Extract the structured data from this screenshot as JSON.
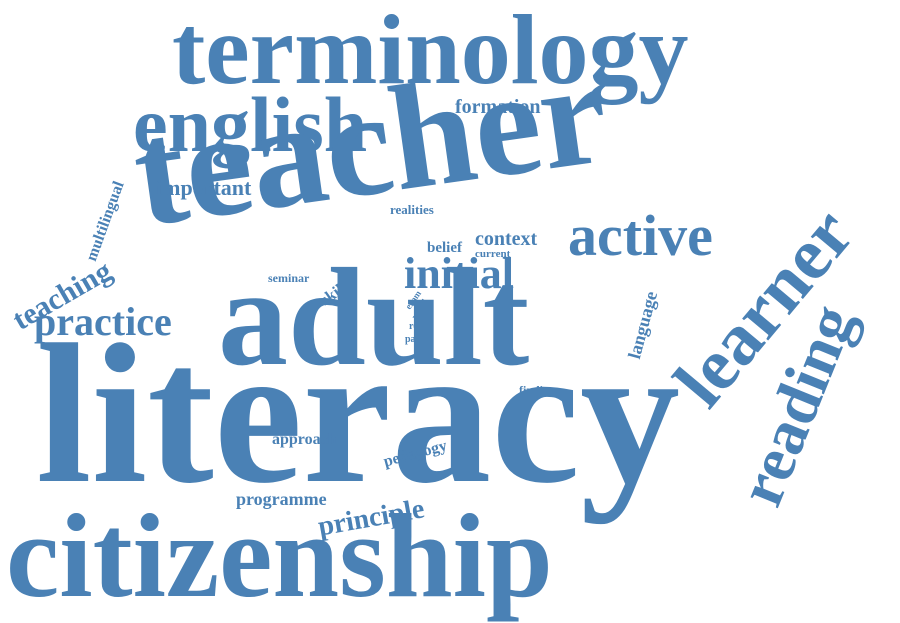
{
  "cloud": {
    "color": "#4a81b5",
    "words": [
      "terminology",
      "english",
      "formation",
      "teacher",
      "important",
      "multilingual",
      "learner",
      "active",
      "realities",
      "context",
      "belief",
      "current",
      "initial",
      "teaching",
      "seminar",
      "skill",
      "practice",
      "exam",
      "need",
      "role",
      "paper",
      "cohort",
      "language",
      "adult",
      "reading",
      "finding",
      "literacy",
      "approach",
      "pedagogy",
      "programme",
      "principle",
      "citizenship"
    ]
  }
}
